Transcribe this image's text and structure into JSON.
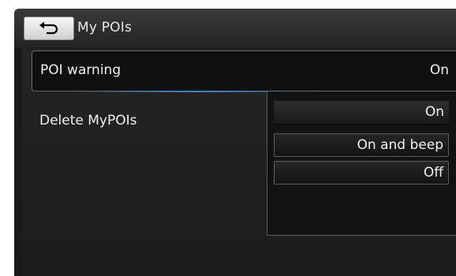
{
  "header": {
    "title": "My POIs",
    "back_icon": "back-arrow-icon"
  },
  "settings": {
    "poi_warning": {
      "label": "POI warning",
      "value": "On"
    },
    "delete_mypois": {
      "label": "Delete MyPOIs"
    }
  },
  "dropdown": {
    "options": [
      "On",
      "On and beep",
      "Off"
    ],
    "selected": "On"
  }
}
